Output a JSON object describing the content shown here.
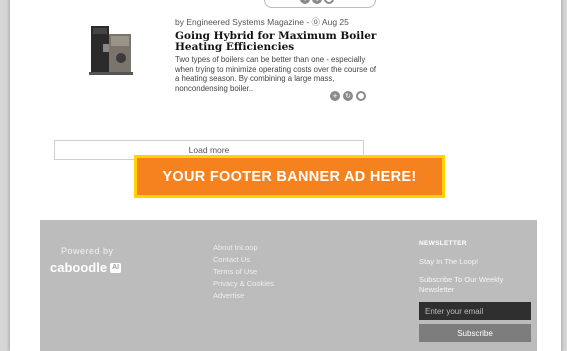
{
  "article": {
    "meta": "by Engineered Systems Magazine - ⓪ Aug 25",
    "title": "Going Hybrid for Maximum Boiler Heating Efficiencies",
    "excerpt": "Two types of boilers can be better than one - especially when trying to minimize operating costs over the course of a heating season. By combining a large mass, noncondensing boiler..",
    "icons": [
      "plus-circle-icon",
      "share-circle-icon",
      "ring-circle-icon"
    ]
  },
  "load_more": {
    "label": "Load more"
  },
  "ad_banner": {
    "text": "YOUR FOOTER BANNER AD HERE!"
  },
  "footer": {
    "powered_by": "Powered by",
    "brand": "caboodle",
    "brand_badge": "AI",
    "links": [
      "About InLoop",
      "Contact Us",
      "Terms of Use",
      "Privacy & Cookies",
      "Advertise"
    ],
    "newsletter": {
      "heading": "NEWSLETTER",
      "tagline": "Stay In The Loop!",
      "prompt": "Subscribe To Our Weekly Newsletter",
      "email_placeholder": "Enter your email",
      "subscribe_label": "Subscribe"
    }
  },
  "colors": {
    "ad_fill": "#f5821f",
    "ad_border": "#ffd200",
    "footer_bg": "#bcbcbc",
    "email_bg": "#2f2f2f",
    "subscribe_bg": "#7d7d7d"
  }
}
